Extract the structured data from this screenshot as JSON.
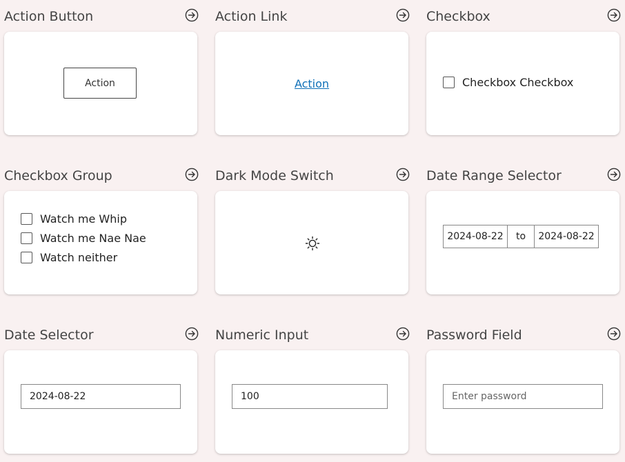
{
  "cells": {
    "action_button": {
      "title": "Action Button",
      "button_label": "Action"
    },
    "action_link": {
      "title": "Action Link",
      "link_label": "Action"
    },
    "checkbox": {
      "title": "Checkbox",
      "label": "Checkbox Checkbox",
      "checked": false
    },
    "checkbox_group": {
      "title": "Checkbox Group",
      "options": [
        {
          "label": "Watch me Whip",
          "checked": false
        },
        {
          "label": "Watch me Nae Nae",
          "checked": false
        },
        {
          "label": "Watch neither",
          "checked": false
        }
      ]
    },
    "dark_mode_switch": {
      "title": "Dark Mode Switch",
      "icon": "sun-icon"
    },
    "date_range_selector": {
      "title": "Date Range Selector",
      "start": "2024-08-22",
      "separator": "to",
      "end": "2024-08-22"
    },
    "date_selector": {
      "title": "Date Selector",
      "value": "2024-08-22"
    },
    "numeric_input": {
      "title": "Numeric Input",
      "value": "100"
    },
    "password_field": {
      "title": "Password Field",
      "placeholder": "Enter password",
      "value": ""
    }
  },
  "icons": {
    "cell_link": "arrow-right-circle-icon"
  },
  "colors": {
    "background": "#f9f1f1",
    "link": "#0f70b8",
    "card": "#ffffff"
  }
}
